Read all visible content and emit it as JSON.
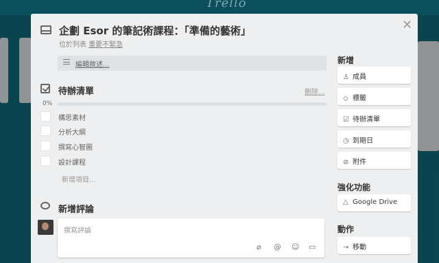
{
  "background": {
    "logo": "Trello"
  },
  "card": {
    "title": "企劃 Esor 的筆記術課程：「準備的藝術」",
    "in_list_prefix": "位於列表 ",
    "list_name": "重要不緊急"
  },
  "description": {
    "edit_label": "編輯敘述..."
  },
  "checklist": {
    "title": "待辦清單",
    "delete_label": "刪除...",
    "progress_label": "0%",
    "progress": 0,
    "items": [
      "構思素材",
      "分析大綱",
      "撰寫心智圖",
      "設計課程"
    ],
    "add_item_label": "新增項目..."
  },
  "comment": {
    "title": "新增評論",
    "placeholder": "撰寫評論"
  },
  "sidebar": {
    "add_heading": "新增",
    "add_buttons": [
      {
        "icon": "person-icon",
        "label": "成員"
      },
      {
        "icon": "tag-icon",
        "label": "標籤"
      },
      {
        "icon": "checklist-icon",
        "label": "待辦清單"
      },
      {
        "icon": "clock-icon",
        "label": "到期日"
      },
      {
        "icon": "paperclip-icon",
        "label": "附件"
      }
    ],
    "powerups_heading": "強化功能",
    "google_drive_label": "Google Drive",
    "actions_heading": "動作",
    "move_label": "移動"
  }
}
